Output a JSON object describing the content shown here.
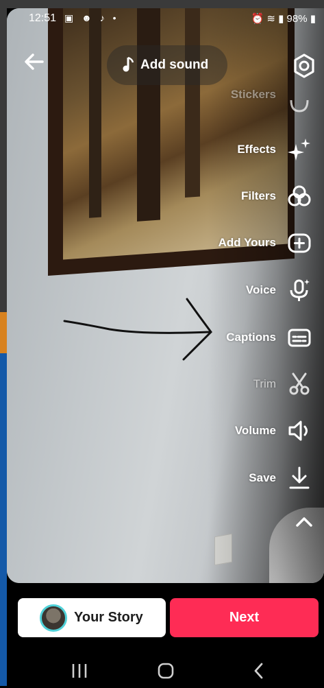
{
  "status_bar": {
    "time": "12:51",
    "notification_icons": "▣ ☻ ♪ •",
    "battery": "98%"
  },
  "top": {
    "add_sound_label": "Add sound"
  },
  "tools": [
    {
      "label": "Stickers",
      "icon": "sticker-icon"
    },
    {
      "label": "Effects",
      "icon": "sparkle-icon"
    },
    {
      "label": "Filters",
      "icon": "filters-icon"
    },
    {
      "label": "Add Yours",
      "icon": "plus-box-icon"
    },
    {
      "label": "Voice",
      "icon": "voice-effects-icon"
    },
    {
      "label": "Captions",
      "icon": "captions-icon"
    },
    {
      "label": "Trim",
      "icon": "scissors-icon"
    },
    {
      "label": "Volume",
      "icon": "speaker-icon"
    },
    {
      "label": "Save",
      "icon": "download-icon"
    }
  ],
  "bottom": {
    "your_story_label": "Your Story",
    "next_label": "Next"
  },
  "colors": {
    "next_button": "#fe2c55",
    "avatar_ring": "#4fd1d8"
  }
}
